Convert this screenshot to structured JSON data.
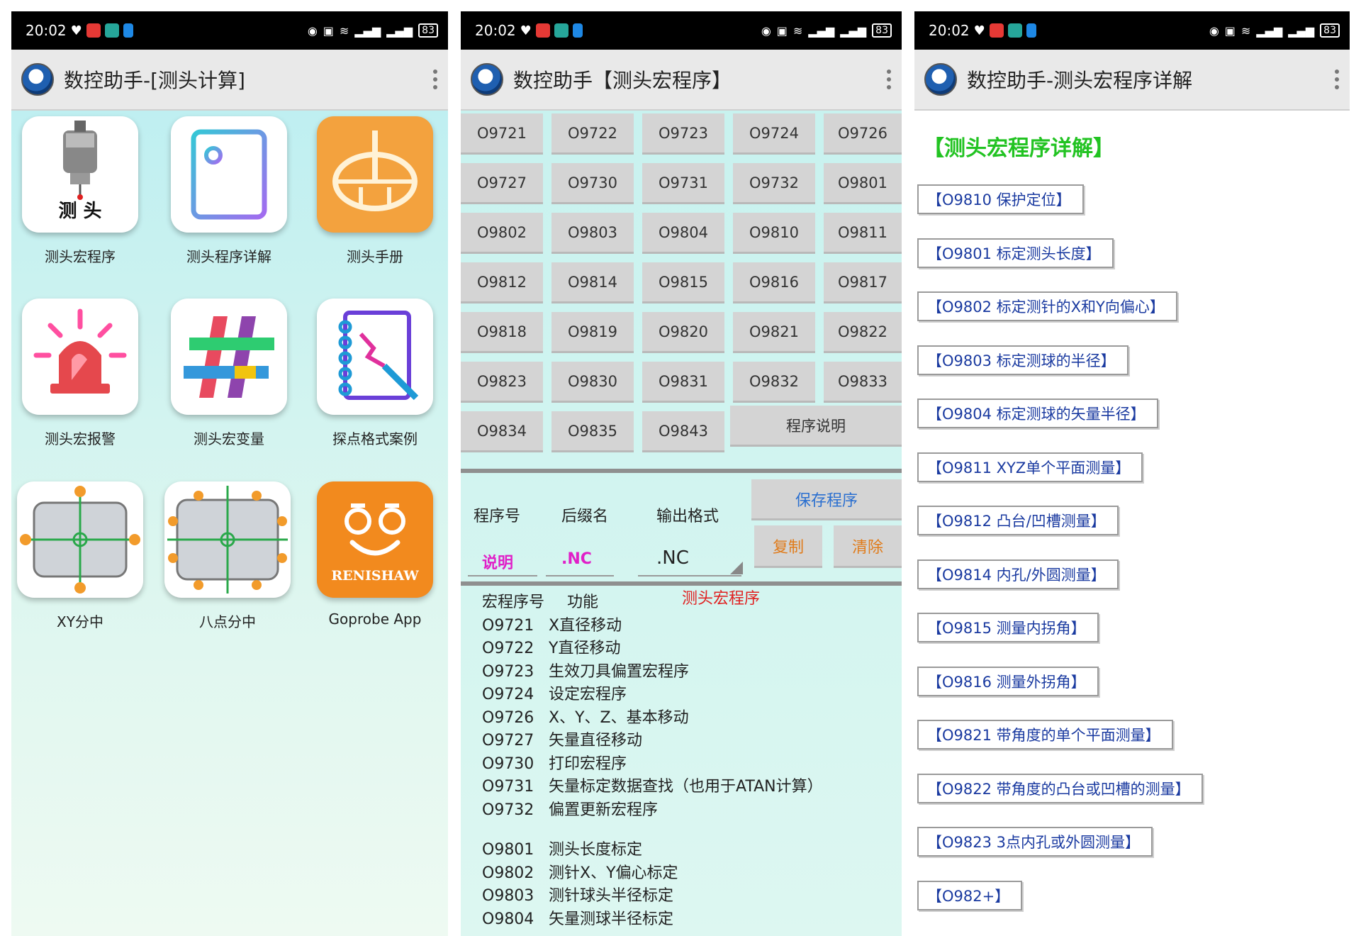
{
  "status": {
    "time": "20:02",
    "battery": "83"
  },
  "panel1": {
    "title": "数控助手-[测头计算]",
    "tiles": [
      {
        "label": "测头宏程序",
        "icon": "probe-icon",
        "caption": "测 头"
      },
      {
        "label": "测头程序详解",
        "icon": "document-icon"
      },
      {
        "label": "测头手册",
        "icon": "handbook-icon"
      },
      {
        "label": "测头宏报警",
        "icon": "alarm-icon"
      },
      {
        "label": "测头宏变量",
        "icon": "hashtag-icon"
      },
      {
        "label": "探点格式案例",
        "icon": "notebook-icon"
      },
      {
        "label": "XY分中",
        "icon": "xy-center-icon"
      },
      {
        "label": "八点分中",
        "icon": "eight-point-icon"
      },
      {
        "label": "Goprobe App",
        "icon": "renishaw-icon",
        "caption": "RENISHAW"
      }
    ]
  },
  "panel2": {
    "title": "数控助手【测头宏程序】",
    "programs": [
      "O9721",
      "O9722",
      "O9723",
      "O9724",
      "O9726",
      "O9727",
      "O9730",
      "O9731",
      "O9732",
      "O9801",
      "O9802",
      "O9803",
      "O9804",
      "O9810",
      "O9811",
      "O9812",
      "O9814",
      "O9815",
      "O9816",
      "O9817",
      "O9818",
      "O9819",
      "O9820",
      "O9821",
      "O9822",
      "O9823",
      "O9830",
      "O9831",
      "O9832",
      "O9833",
      "O9834",
      "O9835",
      "O9843"
    ],
    "program_desc_btn": "程序说明",
    "options": {
      "program_no": "程序号",
      "suffix": "后缀名",
      "output_format": "输出格式",
      "program_no_value": "说明",
      "suffix_value": ".NC",
      "format_value": ".NC"
    },
    "save_btn": "保存程序",
    "copy_btn": "复制",
    "clear_btn": "清除",
    "list_header": {
      "code": "宏程序号",
      "func": "功能",
      "tag": "测头宏程序"
    },
    "list_a": [
      {
        "code": "O9721",
        "func": "X直径移动"
      },
      {
        "code": "O9722",
        "func": "Y直径移动"
      },
      {
        "code": "O9723",
        "func": "生效刀具偏置宏程序"
      },
      {
        "code": "O9724",
        "func": "设定宏程序"
      },
      {
        "code": "O9726",
        "func": "X、Y、Z、基本移动"
      },
      {
        "code": "O9727",
        "func": "矢量直径移动"
      },
      {
        "code": "O9730",
        "func": "打印宏程序"
      },
      {
        "code": "O9731",
        "func": "矢量标定数据查找（也用于ATAN计算）"
      },
      {
        "code": "O9732",
        "func": "偏置更新宏程序"
      }
    ],
    "list_b": [
      {
        "code": "O9801",
        "func": "测头长度标定"
      },
      {
        "code": "O9802",
        "func": "测针X、Y偏心标定"
      },
      {
        "code": "O9803",
        "func": "测针球头半径标定"
      },
      {
        "code": "O9804",
        "func": "矢量测球半径标定"
      }
    ]
  },
  "panel3": {
    "title": "数控助手-测头宏程序详解",
    "heading": "【测头宏程序详解】",
    "links": [
      "【O9810 保护定位】",
      "【O9801 标定测头长度】",
      "【O9802 标定测针的X和Y向偏心】",
      "【O9803 标定测球的半径】",
      "【O9804 标定测球的矢量半径】",
      "【O9811 XYZ单个平面测量】",
      "【O9812 凸台/凹槽测量】",
      "【O9814 内孔/外圆测量】",
      "【O9815 测量内拐角】",
      "【O9816 测量外拐角】",
      "【O9821 带角度的单个平面测量】",
      "【O9822 带角度的凸台或凹槽的测量】",
      "【O9823 3点内孔或外圆测量】",
      "【O982+】"
    ]
  },
  "colors": {
    "accent_green": "#22c322",
    "link_blue": "#1a3aa0",
    "pink": "#e020c8",
    "orange": "#e07b1a",
    "renishaw": "#f28a1e"
  }
}
